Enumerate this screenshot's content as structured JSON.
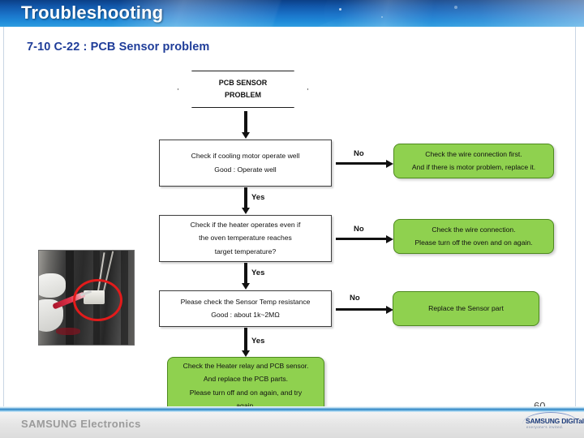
{
  "header": {
    "title": "Troubleshooting"
  },
  "slide": {
    "title": "7-10 C-22 : PCB Sensor problem",
    "page_number": "60",
    "accent_color": "#1f3d99",
    "banner_color": "#1a74c9",
    "green_color": "#8fd14f"
  },
  "footer": {
    "brand": "SAMSUNG Electronics",
    "logo_main": "SAMSUNG DIGITall",
    "logo_sub": "everyone's invited."
  },
  "photo": {
    "caption": "PCB sensor connector inspection photo"
  },
  "flowchart": {
    "start": {
      "line1": "PCB SENSOR",
      "line2": "PROBLEM"
    },
    "steps": [
      {
        "id": "check-motor",
        "line1": "Check if cooling motor operate well",
        "line2": "Good : Operate well",
        "no_label": "No",
        "yes_label": "Yes",
        "no_result": {
          "line1": "Check the wire connection first.",
          "line2": "And if there is motor problem, replace it."
        }
      },
      {
        "id": "check-heater",
        "line1": "Check if the heater operates even if",
        "line2": "the oven temperature reaches",
        "line3": "target temperature?",
        "no_label": "No",
        "yes_label": "Yes",
        "no_result": {
          "line1": "Check the wire connection.",
          "line2": "Please turn off the oven and on again."
        }
      },
      {
        "id": "check-sensor",
        "line1": "Please check the Sensor Temp resistance",
        "line2": "Good : about 1k~2MΩ",
        "no_label": "No",
        "yes_label": "Yes",
        "no_result": {
          "line1": "Replace the Sensor part"
        }
      }
    ],
    "final": {
      "line1": "Check the Heater relay and PCB sensor.",
      "line2": "And replace the PCB parts.",
      "line3": "Please turn off and on again, and try",
      "line4": "again."
    }
  }
}
